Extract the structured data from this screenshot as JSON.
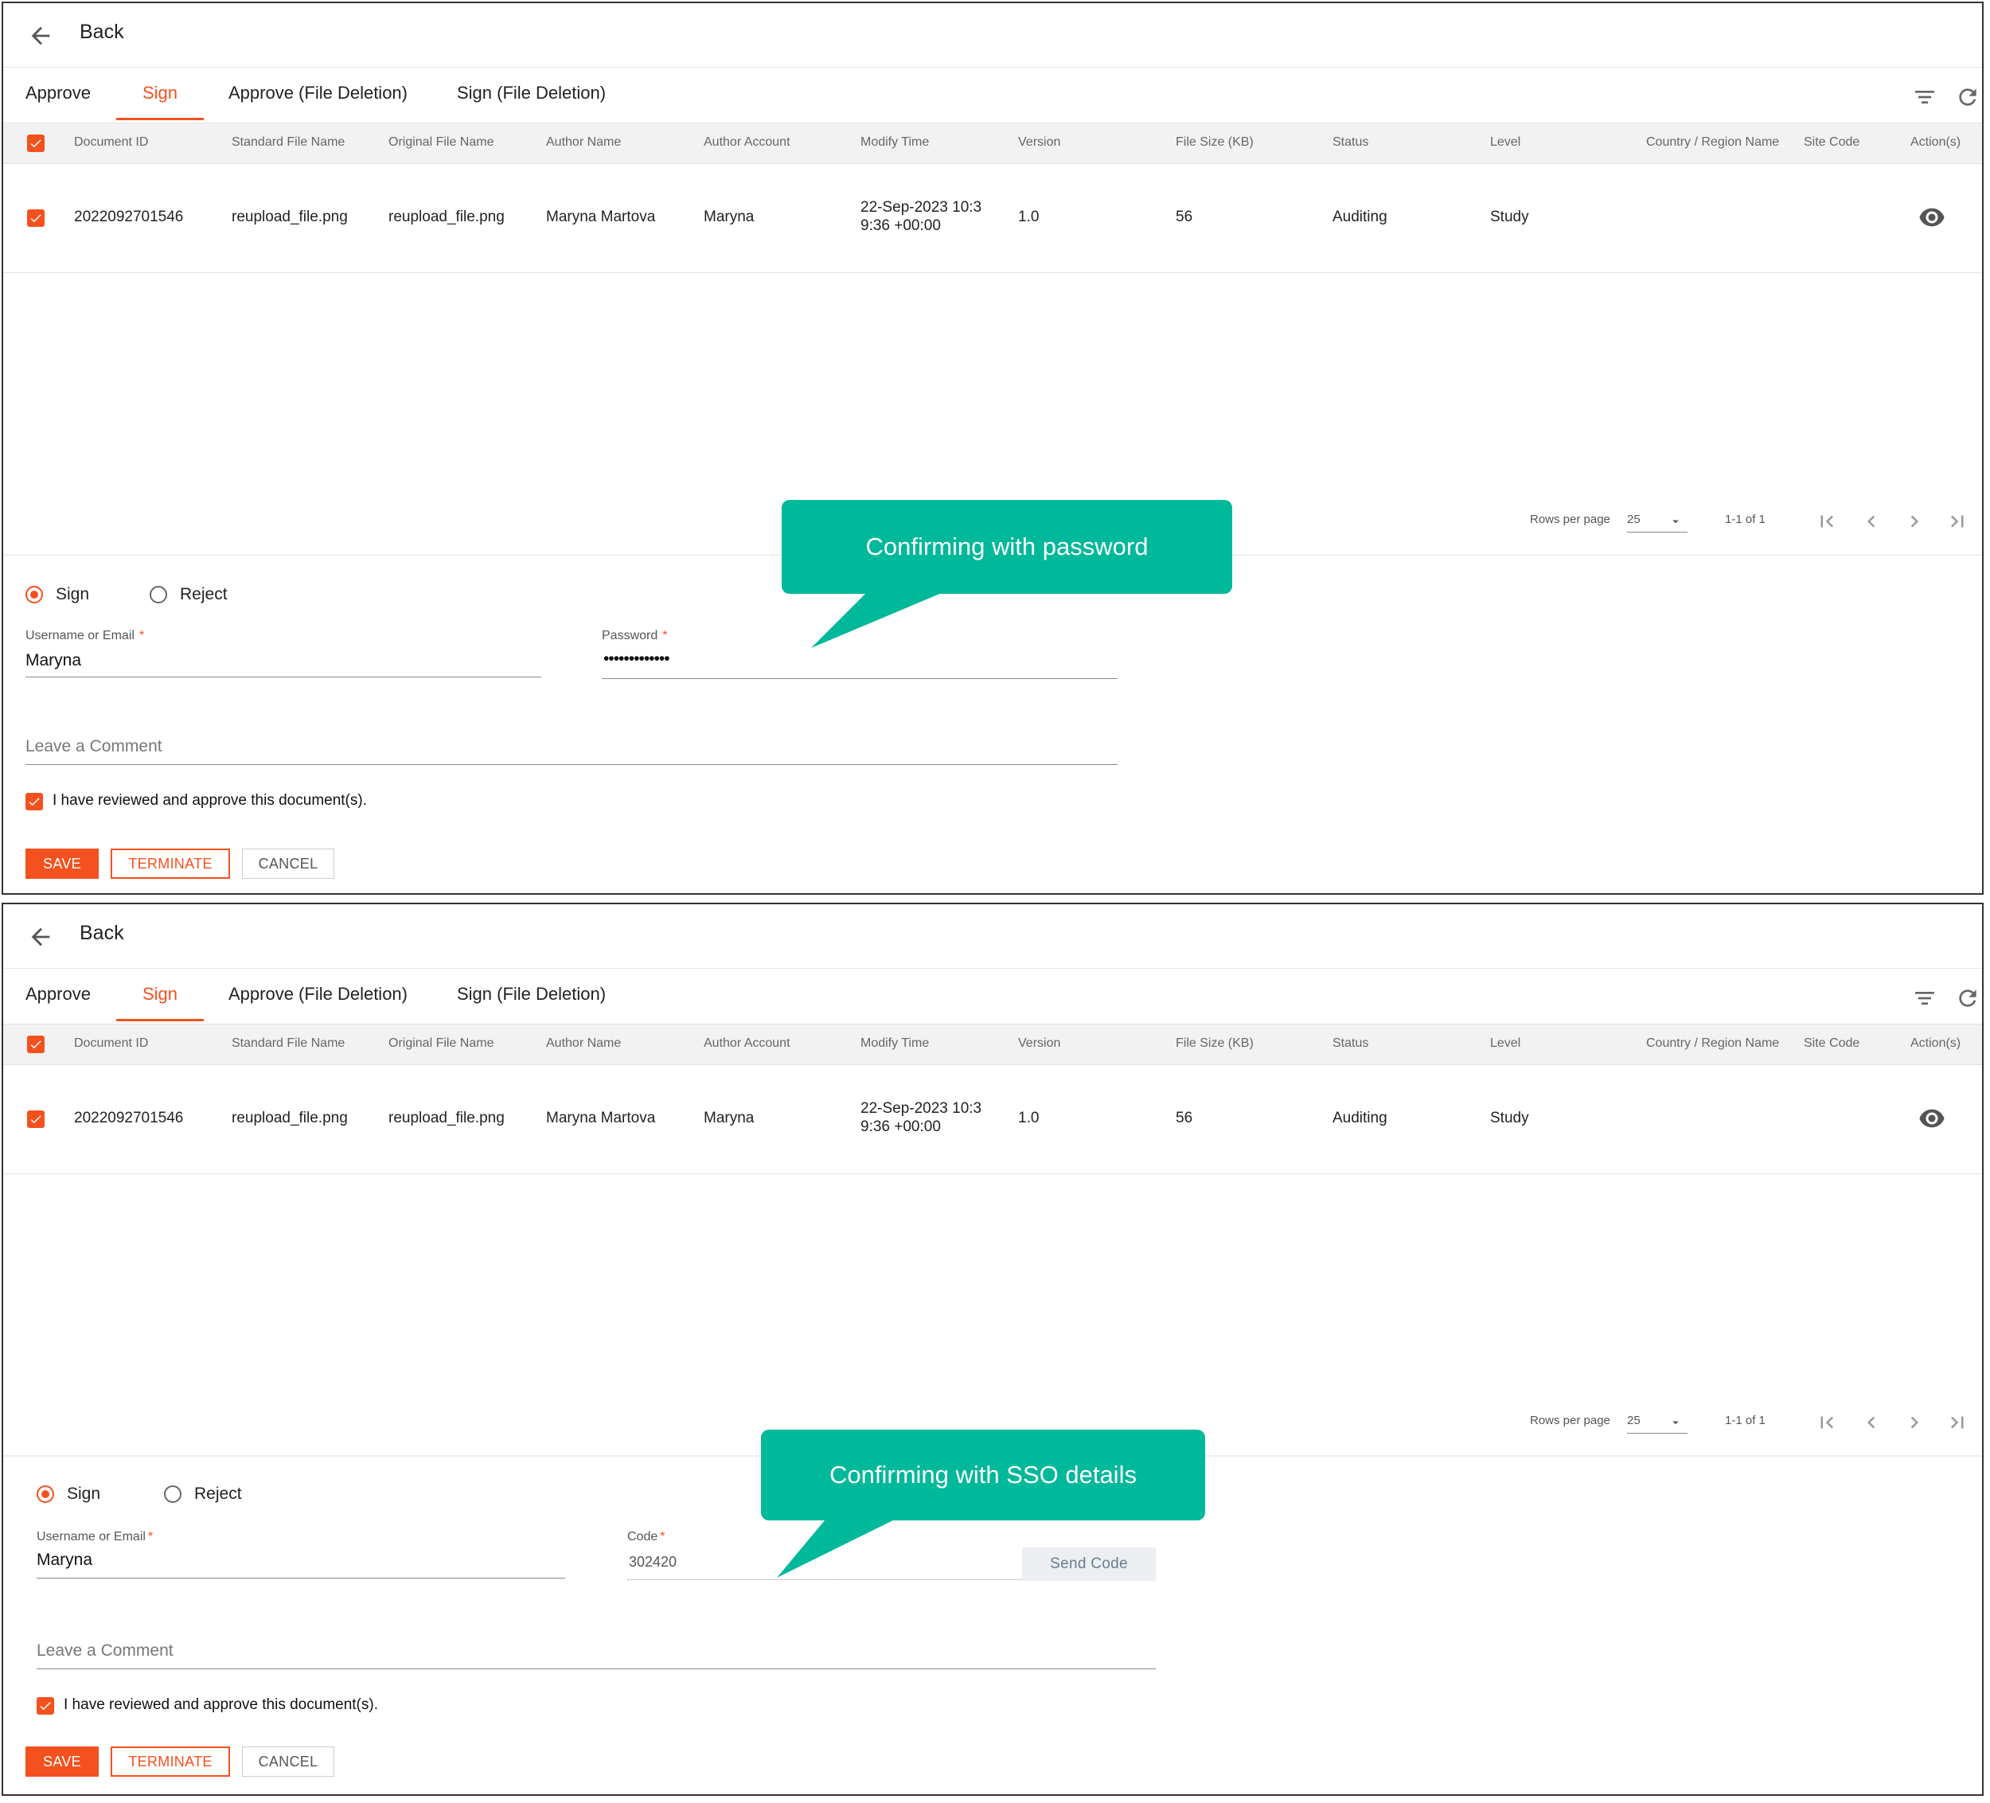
{
  "header": {
    "back_label": "Back"
  },
  "tabs": [
    {
      "label": "Approve"
    },
    {
      "label": "Sign"
    },
    {
      "label": "Approve (File Deletion)"
    },
    {
      "label": "Sign (File Deletion)"
    }
  ],
  "active_tab": "Sign",
  "toolbar": {
    "filter_icon": "filter-icon",
    "refresh_icon": "refresh-icon"
  },
  "table": {
    "columns": [
      "Document ID",
      "Standard File Name",
      "Original File Name",
      "Author Name",
      "Author Account",
      "Modify Time",
      "Version",
      "File Size (KB)",
      "Status",
      "Level",
      "Country / Region Name",
      "Site Code",
      "Action(s)"
    ],
    "rows": [
      {
        "document_id": "2022092701546",
        "standard_file_name": "reupload_file.png",
        "original_file_name": "reupload_file.png",
        "author_name": "Maryna Martova",
        "author_account": "Maryna",
        "modify_time_line1": "22-Sep-2023 10:3",
        "modify_time_line2": "9:36 +00:00",
        "version": "1.0",
        "file_size": "56",
        "status": "Auditing",
        "level": "Study",
        "country_region": "",
        "site_code": "",
        "action_icon": "eye-icon"
      }
    ]
  },
  "pagination": {
    "rows_per_page_label": "Rows per page",
    "rows_per_page": "25",
    "range": "1-1 of 1"
  },
  "form": {
    "radio_sign": "Sign",
    "radio_reject": "Reject",
    "selected": "Sign",
    "username_label": "Username or Email",
    "username_value": "Maryna",
    "password_label": "Password",
    "password_value": "•••••••••••••",
    "code_label": "Code",
    "code_value": "302420",
    "send_code_label": "Send Code",
    "comment_placeholder": "Leave a Comment",
    "approve_checkbox_label": "I have reviewed and approve this document(s).",
    "save_label": "SAVE",
    "terminate_label": "TERMINATE",
    "cancel_label": "CANCEL"
  },
  "callouts": {
    "password": "Confirming with password",
    "sso": "Confirming with SSO details"
  },
  "colors": {
    "accent": "#f4511e",
    "callout": "#00b89a"
  }
}
